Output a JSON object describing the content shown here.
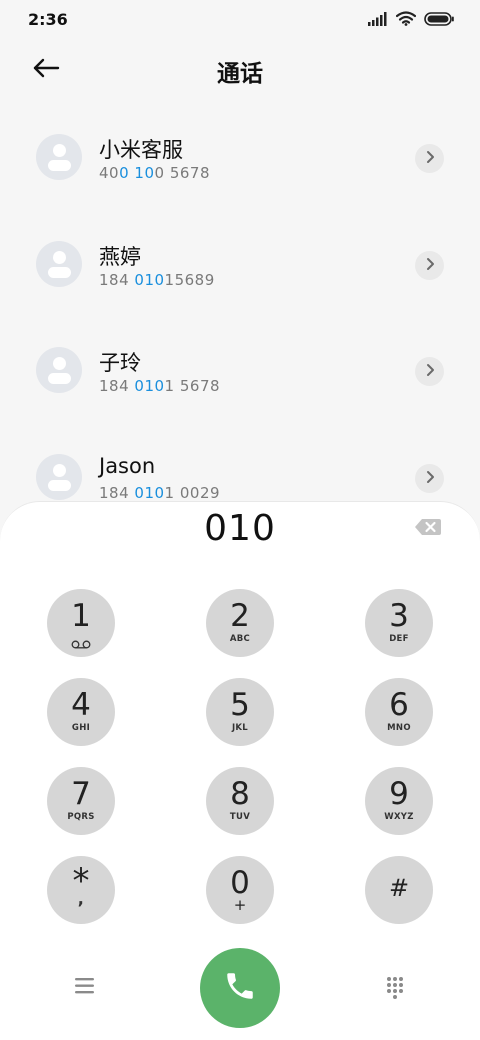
{
  "status_bar": {
    "time": "2:36",
    "icons": [
      "signal-icon",
      "wifi-icon",
      "battery-icon"
    ]
  },
  "header": {
    "title": "通话",
    "back_icon": "arrow-left-icon"
  },
  "contacts": [
    {
      "name": "小米客服",
      "number_parts": [
        "40",
        "0",
        " ",
        "10",
        "0 5678"
      ]
    },
    {
      "name": "燕婷",
      "number_parts": [
        "184 ",
        "010",
        "15689"
      ]
    },
    {
      "name": "子玲",
      "number_parts": [
        "184 ",
        "010",
        "1 5678"
      ]
    },
    {
      "name": "Jason",
      "number_parts": [
        "184 ",
        "010",
        "1 0029"
      ]
    }
  ],
  "dialer": {
    "input_value": "010",
    "keys": [
      {
        "digit": "1",
        "letters": "",
        "icon": "voicemail-icon"
      },
      {
        "digit": "2",
        "letters": "ABC"
      },
      {
        "digit": "3",
        "letters": "DEF"
      },
      {
        "digit": "4",
        "letters": "GHI"
      },
      {
        "digit": "5",
        "letters": "JKL"
      },
      {
        "digit": "6",
        "letters": "MNO"
      },
      {
        "digit": "7",
        "letters": "PQRS"
      },
      {
        "digit": "8",
        "letters": "TUV"
      },
      {
        "digit": "9",
        "letters": "WXYZ"
      },
      {
        "digit": "*",
        "sub": ","
      },
      {
        "digit": "0",
        "sub": "+"
      },
      {
        "digit": "#"
      }
    ]
  },
  "colors": {
    "highlight": "#1a8fdd",
    "call_button": "#5bb36a",
    "key_bg": "#d6d6d6"
  }
}
